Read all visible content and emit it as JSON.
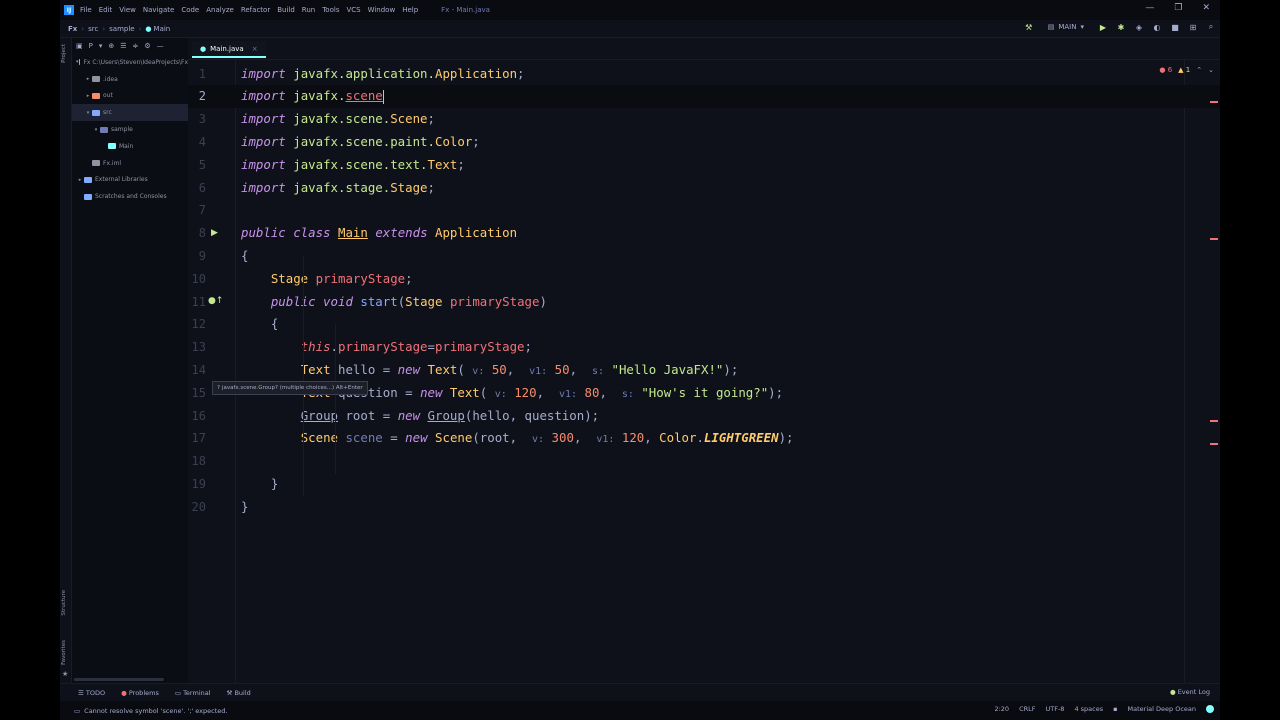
{
  "window": {
    "title": "Fx - Main.java",
    "app_logo": "IJ"
  },
  "menu": [
    "File",
    "Edit",
    "View",
    "Navigate",
    "Code",
    "Analyze",
    "Refactor",
    "Build",
    "Run",
    "Tools",
    "VCS",
    "Window",
    "Help"
  ],
  "window_controls": {
    "minimize": "—",
    "restore": "❐",
    "close": "✕"
  },
  "breadcrumbs": [
    "Fx",
    "src",
    "sample",
    "Main"
  ],
  "run_config": {
    "name": "MAIN"
  },
  "project_panel": {
    "toolbar_label": "P",
    "tree": [
      {
        "label": "Fx  C:\\Users\\Steven\\IdeaProjects\\Fx",
        "depth": 0,
        "expanded": true,
        "color": "#82aaff"
      },
      {
        "label": ".idea",
        "depth": 1,
        "expanded": false,
        "color": "#8f93a2"
      },
      {
        "label": "out",
        "depth": 1,
        "expanded": false,
        "color": "#f78c6c"
      },
      {
        "label": "src",
        "depth": 1,
        "expanded": true,
        "color": "#82aaff",
        "selected": true
      },
      {
        "label": "sample",
        "depth": 2,
        "expanded": true,
        "color": "#717cb4"
      },
      {
        "label": "Main",
        "depth": 3,
        "expanded": null,
        "color": "#84ffff"
      },
      {
        "label": "Fx.iml",
        "depth": 1,
        "expanded": null,
        "color": "#8f93a2"
      },
      {
        "label": "External Libraries",
        "depth": 0,
        "expanded": false,
        "color": "#82aaff"
      },
      {
        "label": "Scratches and Consoles",
        "depth": 0,
        "expanded": null,
        "color": "#82aaff"
      }
    ]
  },
  "side_labels": {
    "project": "Project",
    "structure": "Structure",
    "favorites": "Favorites"
  },
  "editor": {
    "tab": "Main.java",
    "tab_close": "×",
    "inspections": {
      "errors": "6",
      "warnings": "1"
    },
    "tooltip": "javafx.scene.Group? (multiple choices...) Alt+Enter",
    "line_numbers": [
      "1",
      "2",
      "3",
      "4",
      "5",
      "6",
      "7",
      "8",
      "9",
      "10",
      "11",
      "12",
      "13",
      "14",
      "15",
      "16",
      "17",
      "18",
      "19",
      "20"
    ],
    "current_line": 2
  },
  "bottom_tools": [
    "TODO",
    "Problems",
    "Terminal",
    "Build"
  ],
  "event_log": "Event Log",
  "status": {
    "message": "Cannot resolve symbol 'scene'. ';' expected.",
    "position": "2:20",
    "line_sep": "CRLF",
    "encoding": "UTF-8",
    "indent": "4 spaces",
    "theme": "Material Deep Ocean"
  },
  "colors": {
    "background": "#0f111a",
    "accent": "#84ffff",
    "error": "#f07178"
  }
}
